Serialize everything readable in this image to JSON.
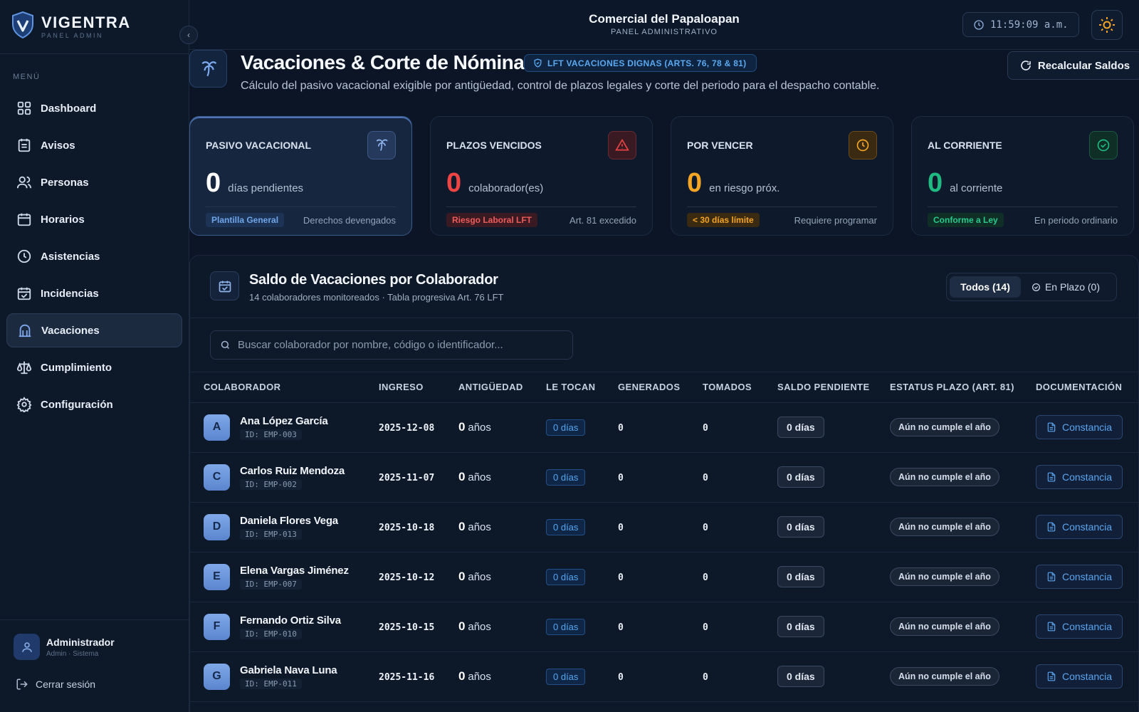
{
  "brand": {
    "name": "VIGENTRA",
    "sub": "PANEL ADMIN"
  },
  "sidebar": {
    "menu_label": "MENÚ",
    "items": [
      {
        "label": "Dashboard",
        "icon": "grid-icon"
      },
      {
        "label": "Avisos",
        "icon": "notice-icon"
      },
      {
        "label": "Personas",
        "icon": "users-icon"
      },
      {
        "label": "Horarios",
        "icon": "calendar-icon"
      },
      {
        "label": "Asistencias",
        "icon": "clock-icon"
      },
      {
        "label": "Incidencias",
        "icon": "calendar-check-icon"
      },
      {
        "label": "Vacaciones",
        "icon": "vacation-icon",
        "active": true
      },
      {
        "label": "Cumplimiento",
        "icon": "scale-icon"
      },
      {
        "label": "Configuración",
        "icon": "gear-icon"
      }
    ],
    "user": {
      "name": "Administrador",
      "role": "Admin · Sistema"
    },
    "logout": "Cerrar sesión"
  },
  "header": {
    "company": "Comercial del Papaloapan",
    "subtitle": "PANEL ADMINISTRATIVO",
    "clock": "11:59:09 a.m."
  },
  "page": {
    "title": "Vacaciones & Corte de Nómina",
    "badge": "LFT VACACIONES DIGNAS (ARTS. 76, 78 & 81)",
    "description": "Cálculo del pasivo vacacional exigible por antigüedad, control de plazos legales y corte del periodo para el despacho contable.",
    "recalc": "Recalcular Saldos"
  },
  "kpis": [
    {
      "label": "PASIVO VACACIONAL",
      "value": "0",
      "unit": "días pendientes",
      "tag": "Plantilla General",
      "note": "Derechos devengados",
      "color": "#ffffff",
      "tag_color": "#6fa6ea",
      "tag_bg": "#1d3356"
    },
    {
      "label": "PLAZOS VENCIDOS",
      "value": "0",
      "unit": "colaborador(es)",
      "tag": "Riesgo Laboral LFT",
      "note": "Art. 81 excedido",
      "color": "#ef4444",
      "tag_color": "#ef5b5b",
      "tag_bg": "#3a1a22"
    },
    {
      "label": "POR VENCER",
      "value": "0",
      "unit": "en riesgo próx.",
      "tag": "< 30 días límite",
      "note": "Requiere programar",
      "color": "#f5a524",
      "tag_color": "#f5a524",
      "tag_bg": "#3a2a12"
    },
    {
      "label": "AL CORRIENTE",
      "value": "0",
      "unit": "al corriente",
      "tag": "Conforme a Ley",
      "note": "En periodo ordinario",
      "color": "#1fb981",
      "tag_color": "#28c98c",
      "tag_bg": "#0f2f26"
    }
  ],
  "table_panel": {
    "title": "Saldo de Vacaciones por Colaborador",
    "subtitle": "14 colaboradores monitoreados · Tabla progresiva Art. 76 LFT",
    "filter_all": "Todos (14)",
    "filter_in": "En Plazo (0)",
    "search_placeholder": "Buscar colaborador por nombre, código o identificador..."
  },
  "columns": [
    "COLABORADOR",
    "INGRESO",
    "ANTIGÜEDAD",
    "LE TOCAN",
    "GENERADOS",
    "TOMADOS",
    "SALDO PENDIENTE",
    "ESTATUS PLAZO (ART. 81)",
    "DOCUMENTACIÓN"
  ],
  "rows": [
    {
      "initial": "A",
      "name": "Ana López García",
      "id": "ID: EMP-003",
      "ingreso": "2025-12-08",
      "years": "0",
      "years_unit": "años",
      "tocan": "0 días",
      "generados": "0",
      "tomados": "0",
      "saldo": "0 días",
      "estatus": "Aún no cumple el año",
      "doc": "Constancia"
    },
    {
      "initial": "C",
      "name": "Carlos Ruiz Mendoza",
      "id": "ID: EMP-002",
      "ingreso": "2025-11-07",
      "years": "0",
      "years_unit": "años",
      "tocan": "0 días",
      "generados": "0",
      "tomados": "0",
      "saldo": "0 días",
      "estatus": "Aún no cumple el año",
      "doc": "Constancia"
    },
    {
      "initial": "D",
      "name": "Daniela Flores Vega",
      "id": "ID: EMP-013",
      "ingreso": "2025-10-18",
      "years": "0",
      "years_unit": "años",
      "tocan": "0 días",
      "generados": "0",
      "tomados": "0",
      "saldo": "0 días",
      "estatus": "Aún no cumple el año",
      "doc": "Constancia"
    },
    {
      "initial": "E",
      "name": "Elena Vargas Jiménez",
      "id": "ID: EMP-007",
      "ingreso": "2025-10-12",
      "years": "0",
      "years_unit": "años",
      "tocan": "0 días",
      "generados": "0",
      "tomados": "0",
      "saldo": "0 días",
      "estatus": "Aún no cumple el año",
      "doc": "Constancia"
    },
    {
      "initial": "F",
      "name": "Fernando Ortiz Silva",
      "id": "ID: EMP-010",
      "ingreso": "2025-10-15",
      "years": "0",
      "years_unit": "años",
      "tocan": "0 días",
      "generados": "0",
      "tomados": "0",
      "saldo": "0 días",
      "estatus": "Aún no cumple el año",
      "doc": "Constancia"
    },
    {
      "initial": "G",
      "name": "Gabriela Nava Luna",
      "id": "ID: EMP-011",
      "ingreso": "2025-11-16",
      "years": "0",
      "years_unit": "años",
      "tocan": "0 días",
      "generados": "0",
      "tomados": "0",
      "saldo": "0 días",
      "estatus": "Aún no cumple el año",
      "doc": "Constancia"
    }
  ]
}
